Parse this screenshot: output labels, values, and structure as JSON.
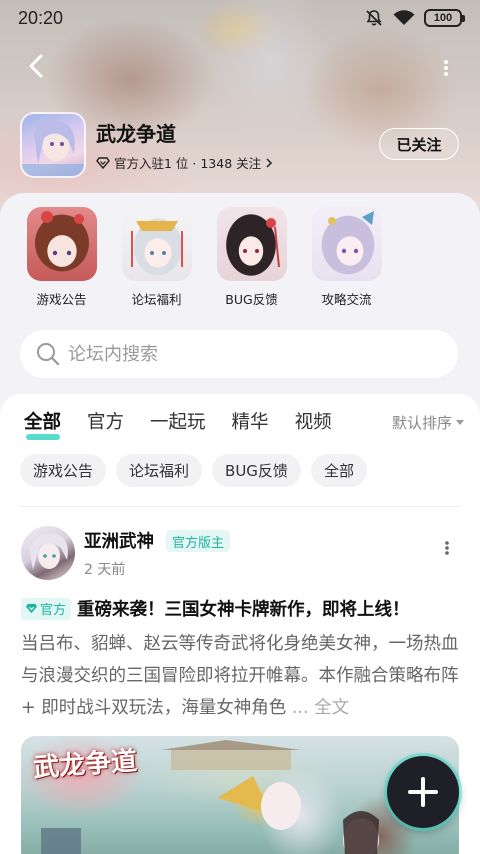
{
  "status_bar": {
    "time": "20:20",
    "battery": "100"
  },
  "forum": {
    "name": "武龙争道",
    "meta": "官方入驻1 位 · 1348 关注",
    "follow_label": "已关注"
  },
  "quick_links": [
    {
      "label": "游戏公告"
    },
    {
      "label": "论坛福利"
    },
    {
      "label": "BUG反馈"
    },
    {
      "label": "攻略交流"
    }
  ],
  "search": {
    "placeholder": "论坛内搜索"
  },
  "tabs": [
    {
      "label": "全部",
      "active": true
    },
    {
      "label": "官方"
    },
    {
      "label": "一起玩"
    },
    {
      "label": "精华"
    },
    {
      "label": "视频"
    }
  ],
  "sort_label": "默认排序",
  "chips": [
    "游戏公告",
    "论坛福利",
    "BUG反馈",
    "全部"
  ],
  "post": {
    "author": "亚洲武神",
    "badge": "官方版主",
    "time": "2 天前",
    "official_tag": "官方",
    "title": "重磅来袭！三国女神卡牌新作，即将上线！",
    "body": "当吕布、貂蝉、赵云等传奇武将化身绝美女神，一场热血与浪漫交织的三国冒险即将拉开帷幕。本作融合策略布阵 + 即时战斗双玩法，海量女神角色",
    "more": "... 全文",
    "image_logo": "武龙争道"
  },
  "colors": {
    "accent": "#1fb3a1",
    "tab_underline": "#3bd6c6",
    "fab": "#1f1f28"
  }
}
